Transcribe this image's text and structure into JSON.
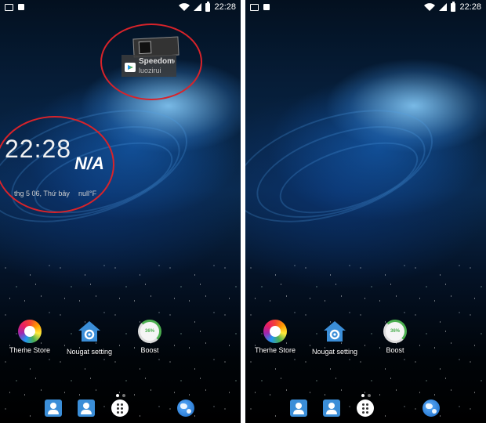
{
  "status_bar": {
    "time": "22:28"
  },
  "widget": {
    "title": "Speedome",
    "subtitle": "luozirui"
  },
  "clock": {
    "time": "22:28",
    "weather": "N/A",
    "date": "thg 5 06, Thứ bảy",
    "temp": "null°F"
  },
  "apps": [
    {
      "label": "Theme Store",
      "icon": "flower-icon"
    },
    {
      "label": "Nougat setting",
      "icon": "home-gear-icon"
    },
    {
      "label": "Boost",
      "icon": "boost-icon",
      "percent": "36%"
    }
  ],
  "dock": [
    "contacts-icon",
    "contacts-icon",
    "app-drawer-icon",
    "browser-globe-icon"
  ],
  "colors": {
    "annotation": "#d8232a",
    "accent": "#3b8ed8",
    "boost": "#4caf50"
  }
}
